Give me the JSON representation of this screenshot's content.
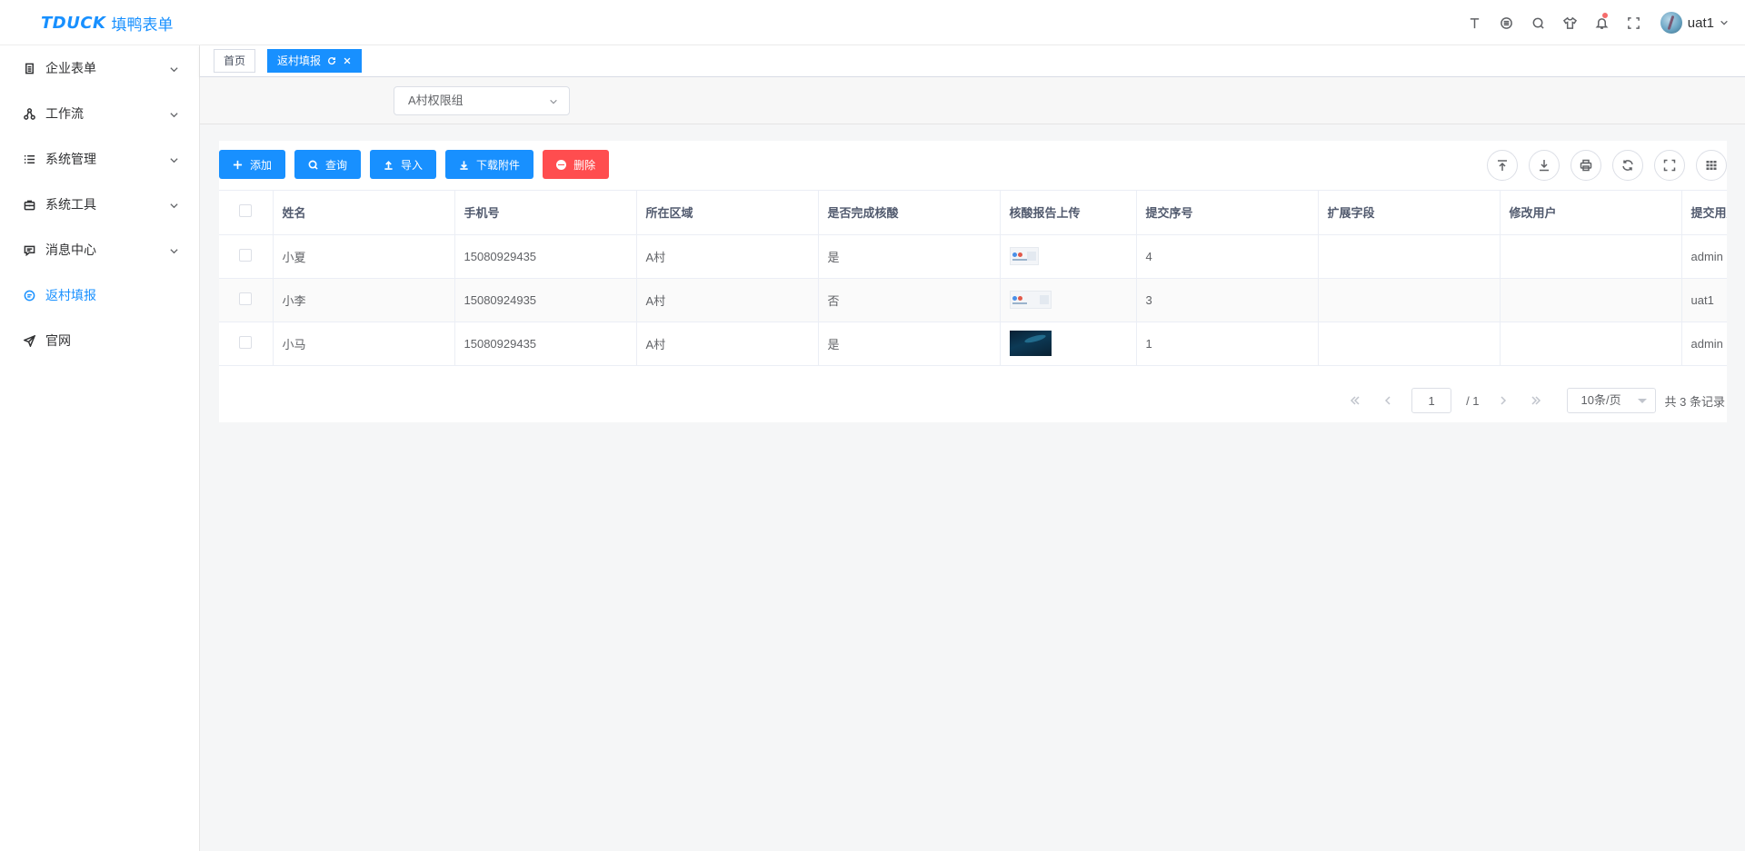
{
  "header": {
    "brand": "TDUCK",
    "brand_cn": "填鸭表单",
    "user_name": "uat1",
    "tools": [
      "text-size-icon",
      "theme-icon",
      "search-icon",
      "skin-icon",
      "bell-icon",
      "fullscreen-icon"
    ]
  },
  "sidebar": {
    "items": [
      {
        "label": "企业表单",
        "icon": "document-icon",
        "expandable": true
      },
      {
        "label": "工作流",
        "icon": "workflow-icon",
        "expandable": true
      },
      {
        "label": "系统管理",
        "icon": "list-icon",
        "expandable": true
      },
      {
        "label": "系统工具",
        "icon": "toolbox-icon",
        "expandable": true
      },
      {
        "label": "消息中心",
        "icon": "message-icon",
        "expandable": true
      },
      {
        "label": "返村填报",
        "icon": "form-icon",
        "expandable": false,
        "active": true
      },
      {
        "label": "官网",
        "icon": "send-icon",
        "expandable": false
      }
    ]
  },
  "tags": [
    {
      "label": "首页",
      "active": false
    },
    {
      "label": "返村填报",
      "active": true
    }
  ],
  "filter": {
    "select_value": "A村权限组"
  },
  "toolbar": {
    "add": "添加",
    "query": "查询",
    "import": "导入",
    "download": "下载附件",
    "delete": "删除"
  },
  "table": {
    "columns": [
      "姓名",
      "手机号",
      "所在区域",
      "是否完成核酸",
      "核酸报告上传",
      "提交序号",
      "扩展字段",
      "修改用户",
      "提交用户"
    ],
    "rows": [
      {
        "name": "小夏",
        "phone": "15080929435",
        "area": "A村",
        "done": "是",
        "thumb": "light",
        "seq": "4",
        "ext": "",
        "modifier": "",
        "submitter": "admin"
      },
      {
        "name": "小李",
        "phone": "15080924935",
        "area": "A村",
        "done": "否",
        "thumb": "light",
        "seq": "3",
        "ext": "",
        "modifier": "",
        "submitter": "uat1"
      },
      {
        "name": "小马",
        "phone": "15080929435",
        "area": "A村",
        "done": "是",
        "thumb": "dark",
        "seq": "1",
        "ext": "",
        "modifier": "",
        "submitter": "admin"
      }
    ]
  },
  "pager": {
    "current": "1",
    "total_pages": "/ 1",
    "page_size": "10条/页",
    "records": "共 3 条记录"
  },
  "colors": {
    "primary": "#1890ff",
    "danger": "#ff4d4f"
  }
}
